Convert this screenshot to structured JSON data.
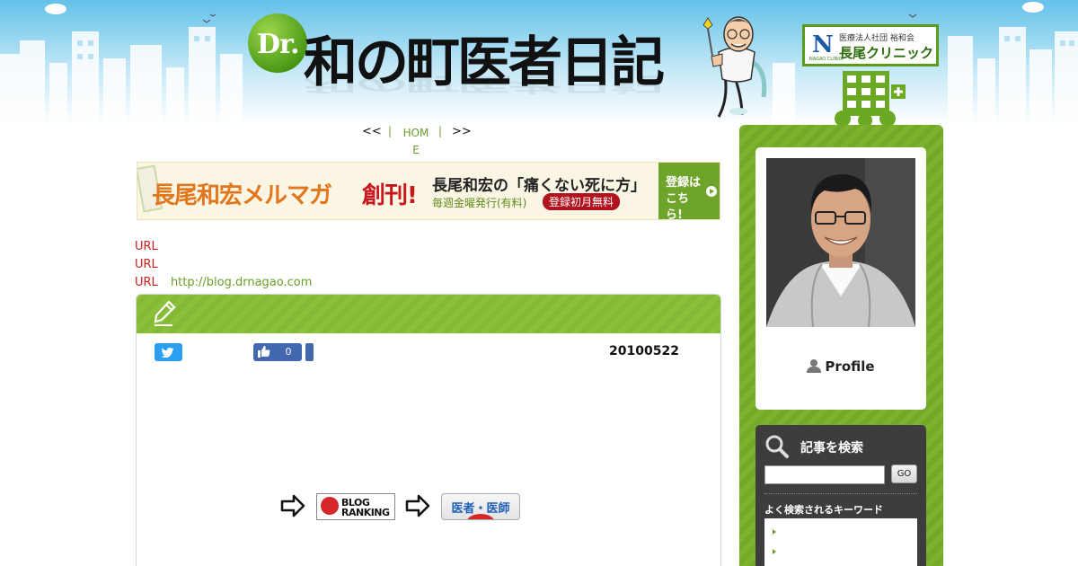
{
  "header": {
    "logo_badge": "Dr.",
    "logo_title": "和の町医者日記",
    "clinic_logo_mark": "N",
    "clinic_logo_mark_label": "NAGAO CLINIC",
    "clinic_subtitle": "医療法人社団 裕和会",
    "clinic_name": "長尾クリニック",
    "icons": [
      "doctor-illustration-icon",
      "clinic-building-icon"
    ]
  },
  "page_nav": {
    "prev": "<<",
    "home": "HOME",
    "next": ">>",
    "separator": "|"
  },
  "banner": {
    "title_a": "長尾和宏メルマガ",
    "title_b": "創刊!",
    "book": "長尾和宏の「痛くない死に方」",
    "weekly": "毎週金曜発行(有料)",
    "free": "登録初月無料",
    "cta": "登録はこちら!"
  },
  "url_lines": [
    {
      "label": "URL",
      "link": ""
    },
    {
      "label": "URL",
      "link": ""
    },
    {
      "label": "URL",
      "link": "http://blog.drnagao.com"
    }
  ],
  "article": {
    "share": {
      "like_count": "0"
    },
    "date": "20100522",
    "ranking_badge": {
      "line1": "BLOG",
      "line2": "RANKING"
    },
    "doctor_badge": "医者・医師"
  },
  "sidebar": {
    "profile_heading": "Profile",
    "search": {
      "title": "記事を検索",
      "input_value": "",
      "button_label": "GO",
      "keywords_title": "よく検索されるキーワード"
    }
  },
  "colors": {
    "accent_green": "#7cb22c",
    "link_green": "#6a9d2a",
    "url_red": "#d21c1c",
    "sky_blue": "#8fd2ef"
  }
}
